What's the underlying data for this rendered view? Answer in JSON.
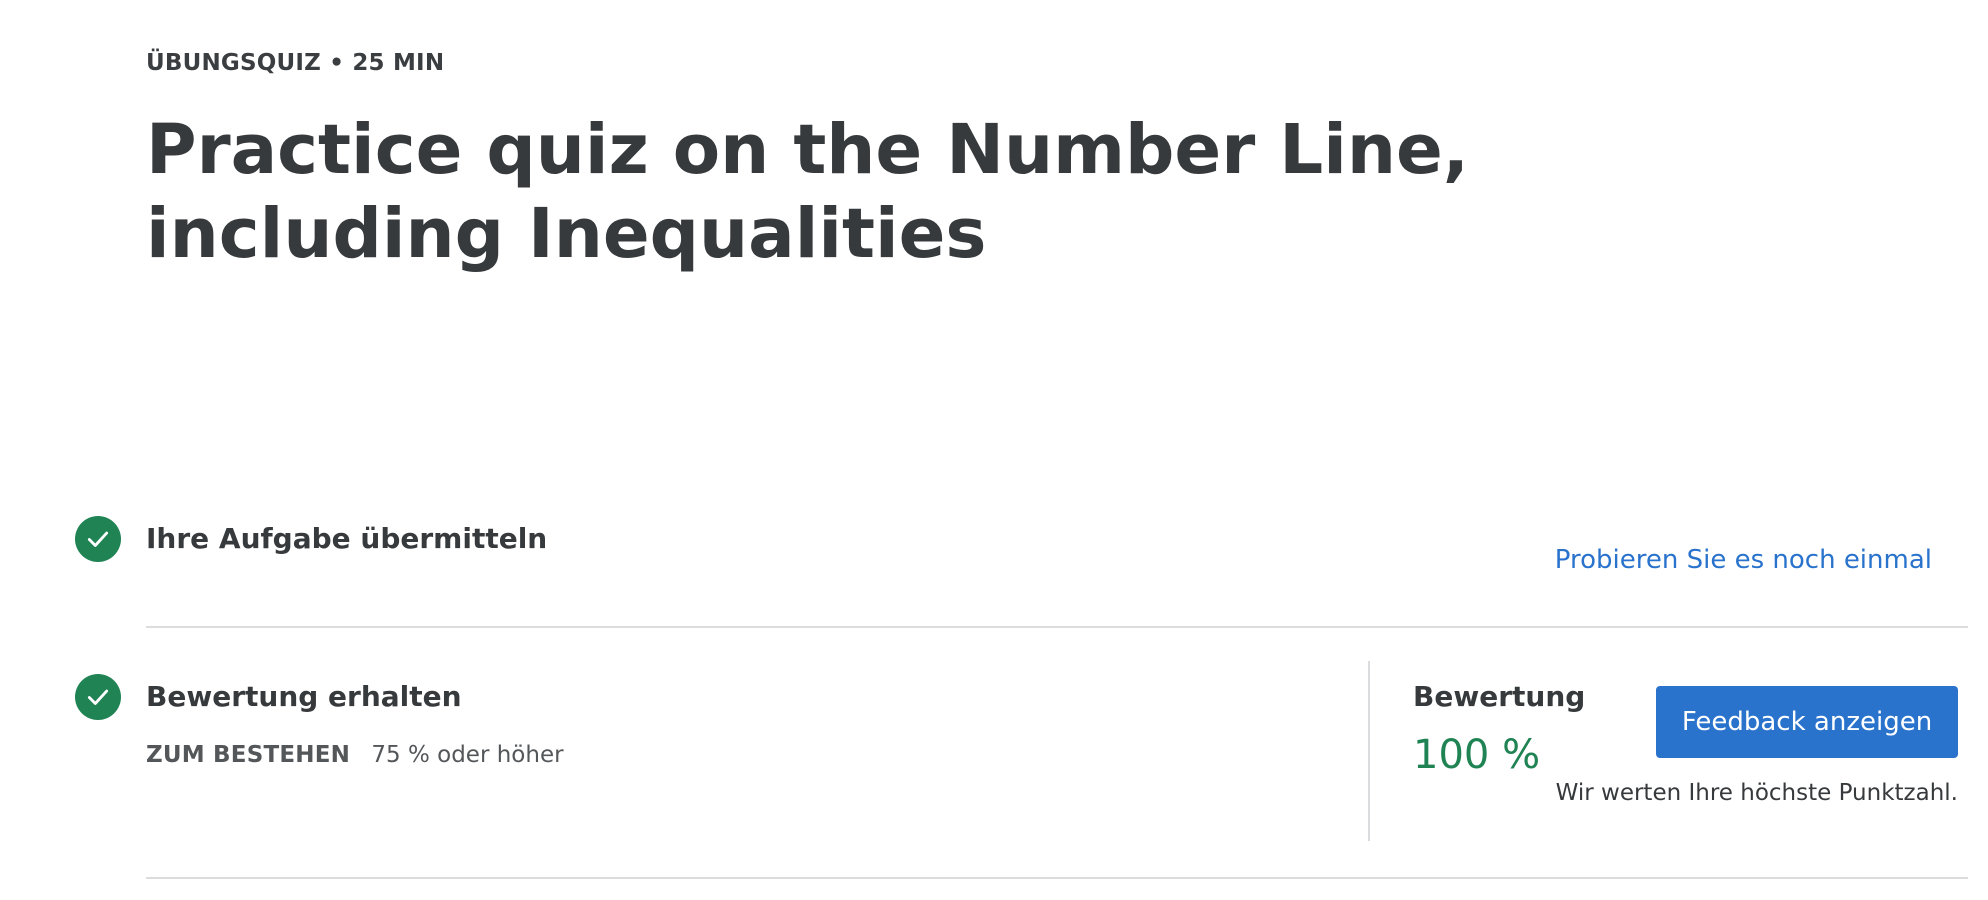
{
  "header": {
    "eyebrow": "ÜBUNGSQUIZ • 25 MIN",
    "title": "Practice quiz on the Number Line, including Inequalities"
  },
  "steps": [
    {
      "title": "Ihre Aufgabe übermitteln",
      "status": "completed",
      "action_label": "Probieren Sie es noch einmal"
    },
    {
      "title": "Bewertung erhalten",
      "status": "completed",
      "pass_label": "ZUM BESTEHEN",
      "pass_value": "75 % oder höher"
    }
  ],
  "grade": {
    "label": "Bewertung",
    "value": "100 %",
    "button_label": "Feedback anzeigen",
    "note": "Wir werten Ihre höchste Punktzahl."
  },
  "colors": {
    "success": "#1f8354",
    "link": "#2a73cc",
    "text": "#373a3c"
  },
  "icons": {
    "step_status": "checkmark-circle-icon"
  }
}
